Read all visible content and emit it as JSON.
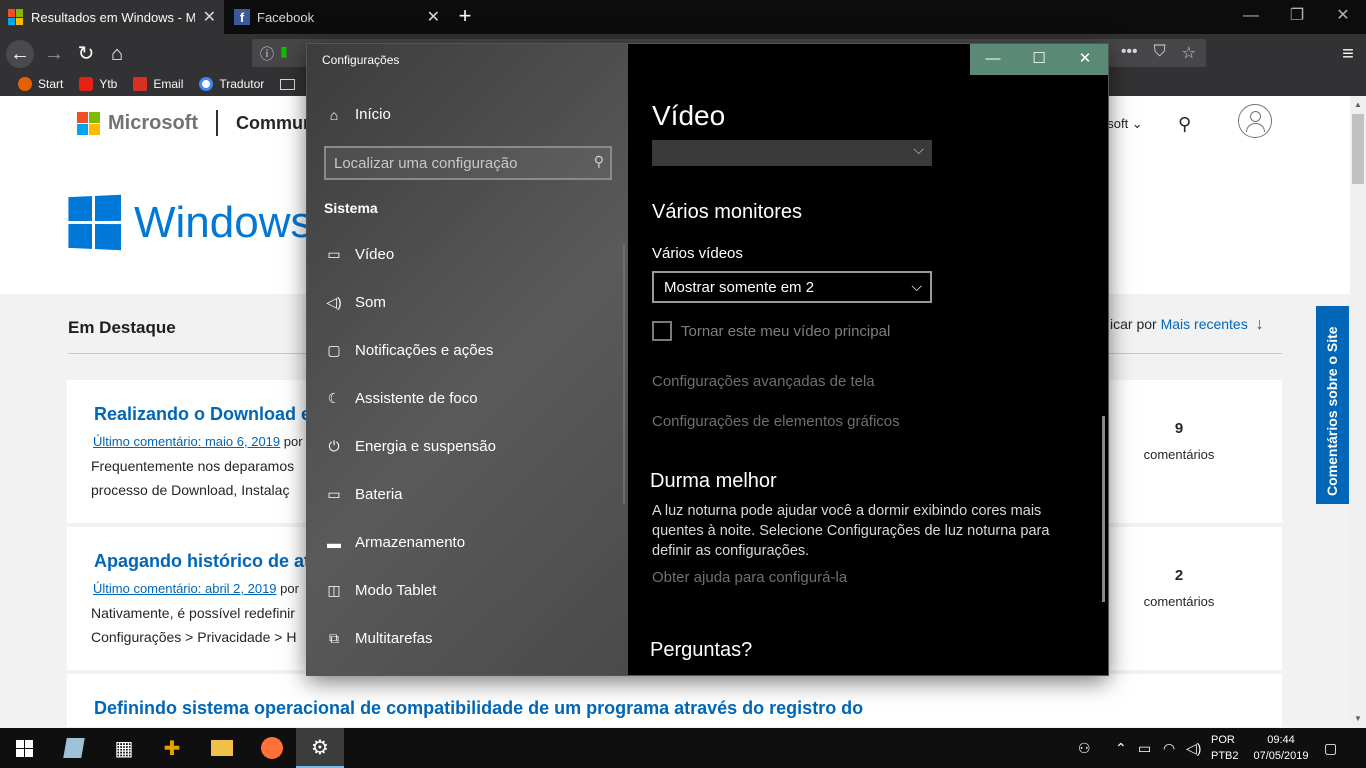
{
  "browser": {
    "tabs": [
      {
        "title": "Resultados em Windows - Micr",
        "active": true
      },
      {
        "title": "Facebook",
        "active": false
      }
    ],
    "bookmarks": [
      {
        "label": "Start",
        "color": "#e66000"
      },
      {
        "label": "Ytb",
        "color": "#e62117"
      },
      {
        "label": "Email",
        "color": "#d93025"
      },
      {
        "label": "Tradutor",
        "color": "#4285f4"
      }
    ]
  },
  "page": {
    "brand": "Microsoft",
    "community": "Commun",
    "windows_word": "Windows",
    "header_right": "osoft ⌄",
    "section_title": "Em Destaque",
    "sort_prefix": "icar por",
    "sort_link": "Mais recentes",
    "side_tab": "Comentários sobre o Site",
    "cards": [
      {
        "title": "Realizando o Download e",
        "meta_link": "Último comentário: maio 6, 2019",
        "meta_suffix": "por",
        "line1": "Frequentemente nos deparamos",
        "line2": "processo de Download, Instalaç",
        "count": "9",
        "count_label": "comentários"
      },
      {
        "title": "Apagando histórico de at",
        "meta_link": "Último comentário: abril 2, 2019",
        "meta_suffix": "por",
        "line1": "Nativamente, é possível redefinir",
        "line2": "Configurações > Privacidade > H",
        "count": "2",
        "count_label": "comentários"
      },
      {
        "title": "Definindo sistema operacional de compatibilidade de um programa através do registro do"
      }
    ]
  },
  "settings": {
    "window_title": "Configurações",
    "home": "Início",
    "search_placeholder": "Localizar uma configuração",
    "section": "Sistema",
    "nav": [
      {
        "label": "Vídeo",
        "icon": "monitor-icon"
      },
      {
        "label": "Som",
        "icon": "speaker-icon"
      },
      {
        "label": "Notificações e ações",
        "icon": "notification-icon"
      },
      {
        "label": "Assistente de foco",
        "icon": "moon-icon"
      },
      {
        "label": "Energia e suspensão",
        "icon": "power-icon"
      },
      {
        "label": "Bateria",
        "icon": "battery-icon"
      },
      {
        "label": "Armazenamento",
        "icon": "storage-icon"
      },
      {
        "label": "Modo Tablet",
        "icon": "tablet-icon"
      },
      {
        "label": "Multitarefas",
        "icon": "multitask-icon"
      }
    ],
    "content": {
      "title": "Vídeo",
      "multi_monitors": "Vários monitores",
      "multi_videos_label": "Vários vídeos",
      "multi_videos_value": "Mostrar somente em 2",
      "main_display_checkbox": "Tornar este meu vídeo principal",
      "advanced_link": "Configurações avançadas de tela",
      "graphics_link": "Configurações de elementos gráficos",
      "sleep_better": "Durma melhor",
      "sleep_text": "A luz noturna pode ajudar você a dormir exibindo cores mais quentes à noite. Selecione Configurações de luz noturna para definir as configurações.",
      "help_link": "Obter ajuda para configurá-la",
      "questions": "Perguntas?"
    }
  },
  "taskbar": {
    "lang_top": "POR",
    "lang_bottom": "PTB2",
    "time": "09:44",
    "date": "07/05/2019"
  },
  "colors": {
    "accent_blue": "#0067b8",
    "windows_blue": "#0078d7",
    "title_buttons": "#5a8a76"
  }
}
